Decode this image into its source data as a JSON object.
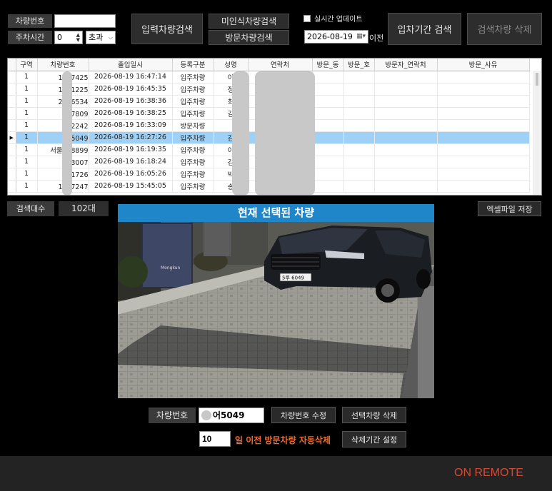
{
  "search": {
    "plate_label": "차량번호",
    "plate_value": "",
    "parking_time_label": "주차시간",
    "parking_time_value": "0",
    "parking_time_unit": "초과",
    "input_search_button": "입력차량검색",
    "unrecognized_search_button": "미인식차량검색",
    "visitor_search_button": "방문차량검색",
    "realtime_update_label": "실시간 업데이트",
    "realtime_update_checked": false,
    "date_value": "2026-08-19",
    "date_suffix": "이전",
    "period_search_button": "입차기간 검색",
    "delete_search_button": "검색차량 삭제"
  },
  "table": {
    "columns": [
      "구역",
      "차량번호",
      "출입일시",
      "등록구분",
      "성명",
      "연락처",
      "방문_동",
      "방문_호",
      "방문자_연락처",
      "방문_사유"
    ],
    "rows": [
      {
        "zone": "1",
        "plate": "1  구7425",
        "time": "2026-08-19 16:47:14",
        "type": "입주차량",
        "name": "이"
      },
      {
        "zone": "1",
        "plate": "1  루1225",
        "time": "2026-08-19 16:45:35",
        "type": "입주차량",
        "name": "정"
      },
      {
        "zone": "1",
        "plate": "2  두6534",
        "time": "2026-08-19 16:38:36",
        "type": "입주차량",
        "name": "최"
      },
      {
        "zone": "1",
        "plate": "  누7809",
        "time": "2026-08-19 16:38:25",
        "type": "입주차량",
        "name": "김"
      },
      {
        "zone": "1",
        "plate": "  주2242",
        "time": "2026-08-19 16:33:09",
        "type": "방문차량",
        "name": ""
      },
      {
        "zone": "1",
        "plate": "  어5049",
        "time": "2026-08-19 16:27:26",
        "type": "입주차량",
        "name": "김"
      },
      {
        "zone": "1",
        "plate": "서울  라8899",
        "time": "2026-08-19 16:19:35",
        "type": "입주차량",
        "name": "이"
      },
      {
        "zone": "1",
        "plate": "  거3007",
        "time": "2026-08-19 16:18:24",
        "type": "입주차량",
        "name": "김"
      },
      {
        "zone": "1",
        "plate": "  도1726",
        "time": "2026-08-19 16:05:26",
        "type": "입주차량",
        "name": "박"
      },
      {
        "zone": "1",
        "plate": "1  루7247",
        "time": "2026-08-19 15:45:05",
        "type": "입주차량",
        "name": "송"
      }
    ]
  },
  "summary": {
    "count_label": "검색대수",
    "count_value": "102대",
    "excel_button": "엑셀파일 저장"
  },
  "camera": {
    "title": "현재 선택된 차량",
    "plate_on_car": "5루 6049",
    "sign_text": "Mongkun"
  },
  "selected": {
    "plate_label": "차량번호",
    "plate_value": "어5049",
    "edit_button": "차량번호 수정",
    "delete_button": "선택차량 삭제",
    "auto_delete_days": "10",
    "auto_delete_text": "일 이전 방문차량 자동삭제",
    "set_period_button": "삭제기간 설정"
  },
  "status": {
    "remote": "ON REMOTE"
  },
  "colors": {
    "selection": "#9fd0f5",
    "accent_blue": "#1f87c9",
    "warning": "#f06a2c",
    "remote": "#d44a35"
  }
}
